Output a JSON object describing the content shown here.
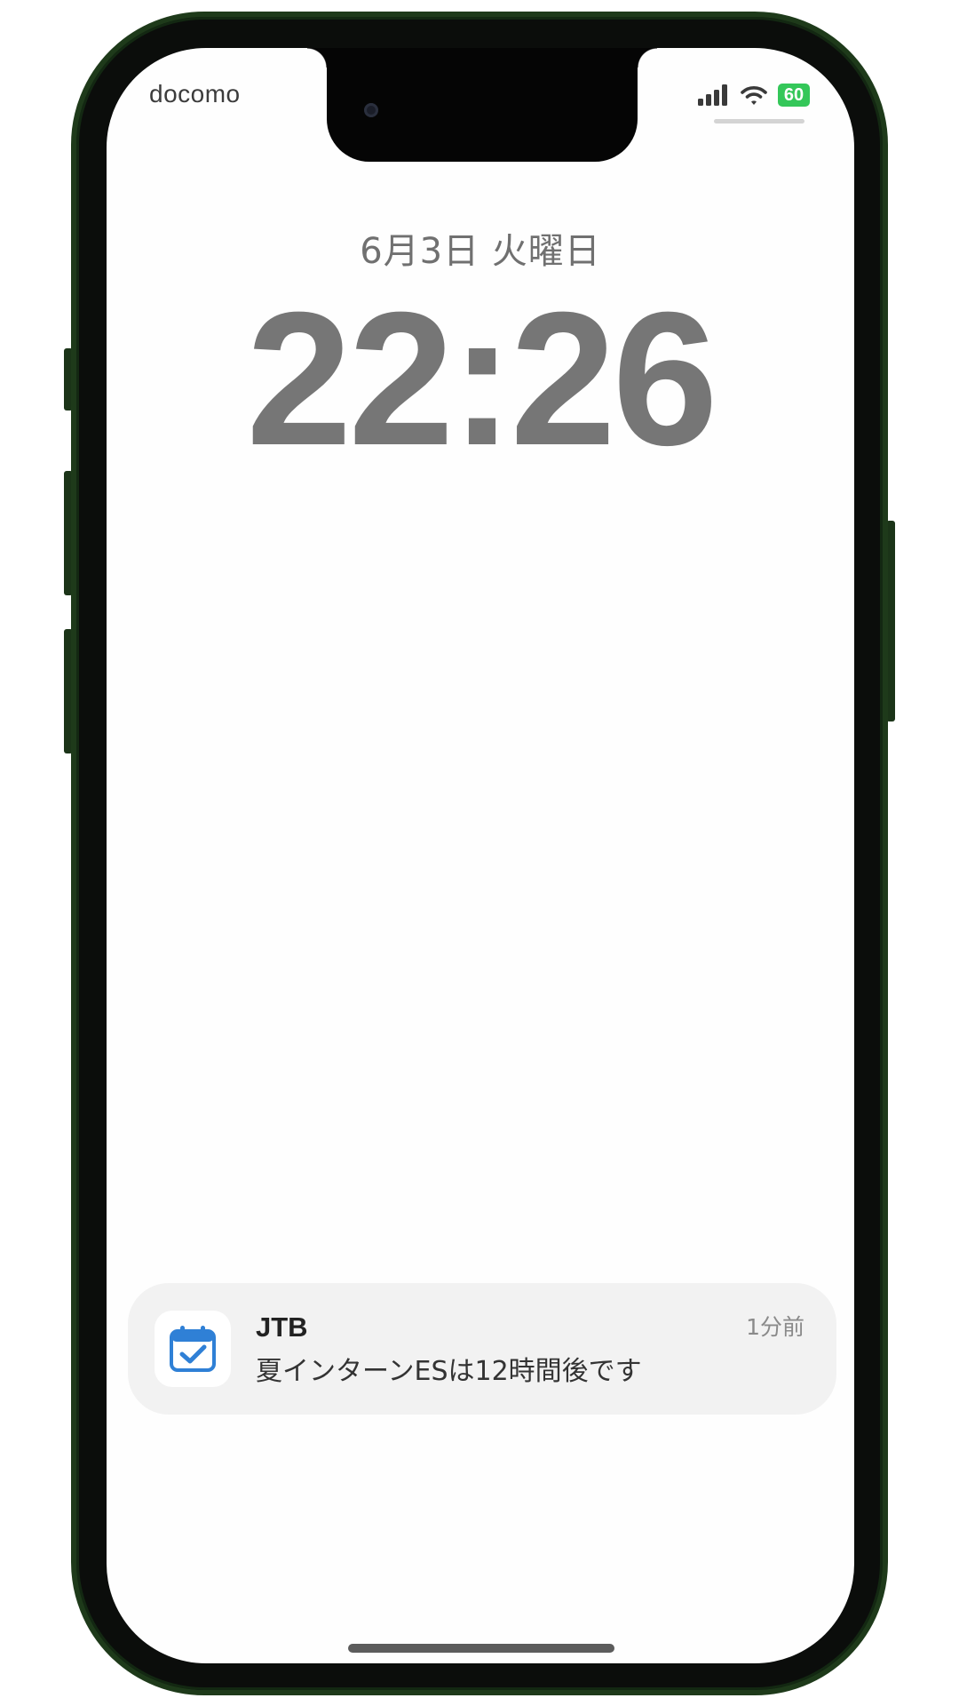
{
  "status_bar": {
    "carrier": "docomo",
    "battery_level": "60",
    "signal_icon": "cellular-signal-icon",
    "wifi_icon": "wifi-icon",
    "battery_color": "#34c759"
  },
  "lock_screen": {
    "date": "6月3日 火曜日",
    "time": "22:26"
  },
  "notification": {
    "app_name": "JTB",
    "time_ago": "1分前",
    "message": "夏インターンESは12時間後です",
    "icon": "calendar-check-icon",
    "icon_color": "#2f80d6"
  }
}
